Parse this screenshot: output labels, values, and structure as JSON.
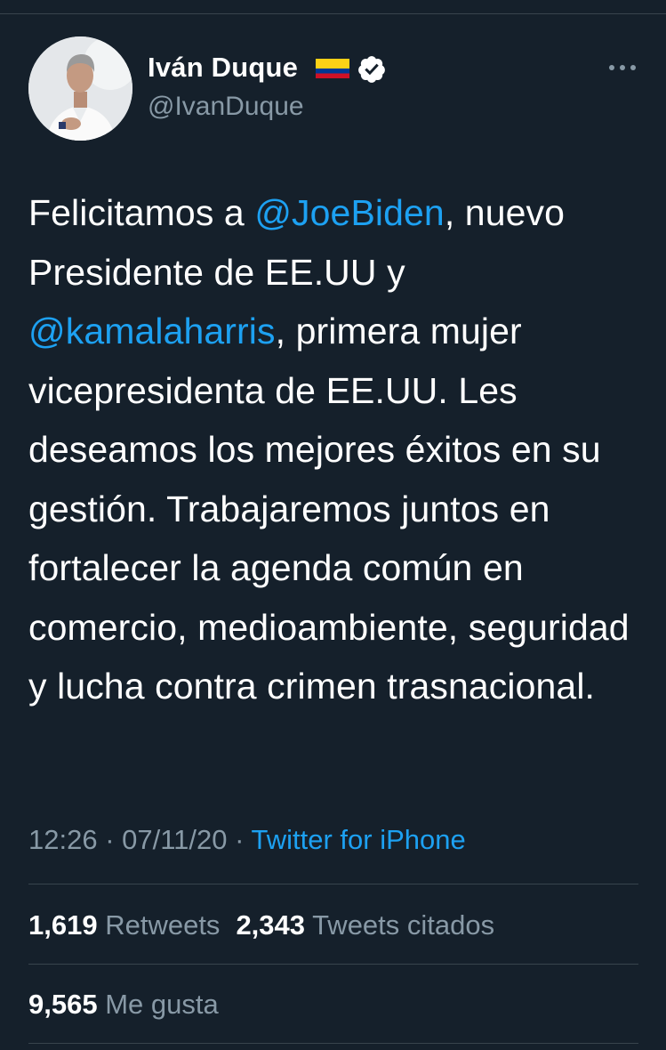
{
  "author": {
    "display_name": "Iván Duque",
    "handle": "@IvanDuque",
    "flag_icon": "colombia-flag-icon",
    "verified_icon": "verified-badge-icon"
  },
  "tweet": {
    "segments": [
      {
        "text": "Felicitamos a ",
        "type": "text"
      },
      {
        "text": "@JoeBiden",
        "type": "mention"
      },
      {
        "text": ", nuevo Presidente de EE.UU y ",
        "type": "text"
      },
      {
        "text": "@kamalaharris",
        "type": "mention"
      },
      {
        "text": ", primera mujer vicepresidenta de EE.UU. Les deseamos los mejores éxitos en su gestión. Trabajaremos juntos en fortalecer la agenda común en comercio, medioambiente, seguridad y lucha contra crimen trasnacional.",
        "type": "text"
      }
    ],
    "time": "12:26",
    "separator": " · ",
    "date": "07/11/20",
    "source": "Twitter for iPhone"
  },
  "stats": {
    "retweets_count": "1,619",
    "retweets_label": "Retweets",
    "quotes_count": "2,343",
    "quotes_label": "Tweets citados",
    "likes_count": "9,565",
    "likes_label": "Me gusta"
  },
  "colors": {
    "background": "#15202b",
    "link": "#1da1f2",
    "secondary_text": "#8899a6",
    "divider": "#38444d"
  }
}
